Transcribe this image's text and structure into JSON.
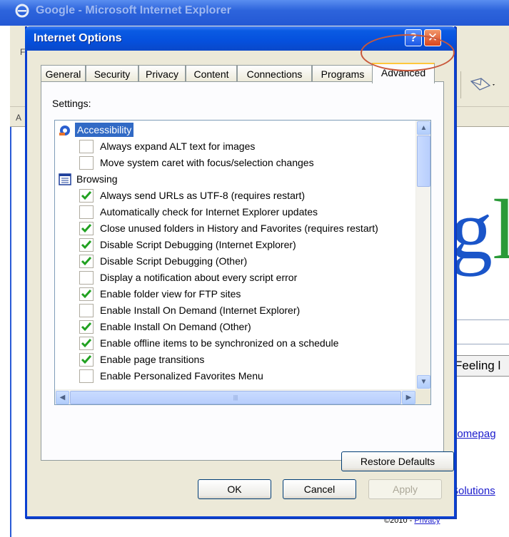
{
  "background_window": {
    "title": "Google - Microsoft Internet Explorer",
    "menu_fragment": "F",
    "address_fragment": "A",
    "logo_fragment": "gl",
    "feeling_button": "Feeling l",
    "homepage_link": "homepag",
    "solutions_link": "Solutions",
    "copyright": "©2010 - ",
    "privacy_link": "Privacy"
  },
  "dialog": {
    "title": "Internet Options",
    "help_label": "?",
    "close_label": "✕",
    "tabs": [
      {
        "label": "General",
        "active": false
      },
      {
        "label": "Security",
        "active": false
      },
      {
        "label": "Privacy",
        "active": false
      },
      {
        "label": "Content",
        "active": false
      },
      {
        "label": "Connections",
        "active": false
      },
      {
        "label": "Programs",
        "active": false
      },
      {
        "label": "Advanced",
        "active": true
      }
    ],
    "settings_label": "Settings:",
    "settings": [
      {
        "type": "group",
        "label": "Accessibility",
        "icon": "accessibility-icon",
        "selected": true
      },
      {
        "type": "item",
        "label": "Always expand ALT text for images",
        "checked": false
      },
      {
        "type": "item",
        "label": "Move system caret with focus/selection changes",
        "checked": false
      },
      {
        "type": "group",
        "label": "Browsing",
        "icon": "browsing-icon",
        "selected": false
      },
      {
        "type": "item",
        "label": "Always send URLs as UTF-8 (requires restart)",
        "checked": true
      },
      {
        "type": "item",
        "label": "Automatically check for Internet Explorer updates",
        "checked": false
      },
      {
        "type": "item",
        "label": "Close unused folders in History and Favorites (requires restart)",
        "checked": true
      },
      {
        "type": "item",
        "label": "Disable Script Debugging (Internet Explorer)",
        "checked": true
      },
      {
        "type": "item",
        "label": "Disable Script Debugging (Other)",
        "checked": true
      },
      {
        "type": "item",
        "label": "Display a notification about every script error",
        "checked": false
      },
      {
        "type": "item",
        "label": "Enable folder view for FTP sites",
        "checked": true
      },
      {
        "type": "item",
        "label": "Enable Install On Demand (Internet Explorer)",
        "checked": false
      },
      {
        "type": "item",
        "label": "Enable Install On Demand (Other)",
        "checked": true
      },
      {
        "type": "item",
        "label": "Enable offline items to be synchronized on a schedule",
        "checked": true
      },
      {
        "type": "item",
        "label": "Enable page transitions",
        "checked": true
      },
      {
        "type": "item",
        "label": "Enable Personalized Favorites Menu",
        "checked": false
      }
    ],
    "buttons": {
      "restore_defaults": "Restore Defaults",
      "ok": "OK",
      "cancel": "Cancel",
      "apply": "Apply"
    }
  },
  "colors": {
    "titlebar": "#0550dd",
    "selection": "#316ac5",
    "check": "#21a121",
    "annotation": "#c9583b",
    "tab_active_highlight": "#ffc83c"
  }
}
